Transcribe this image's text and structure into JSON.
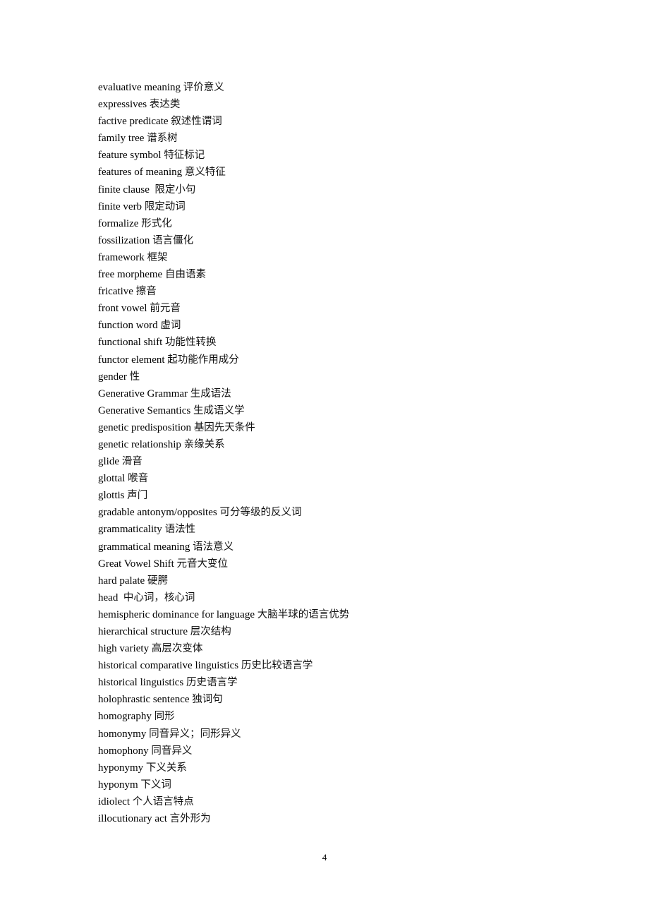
{
  "entries": [
    {
      "en": "evaluative meaning",
      "sep": " ",
      "zh": "评价意义"
    },
    {
      "en": "expressives",
      "sep": " ",
      "zh": "表达类"
    },
    {
      "en": "factive predicate",
      "sep": " ",
      "zh": "叙述性谓词"
    },
    {
      "en": "family tree",
      "sep": " ",
      "zh": "谱系树"
    },
    {
      "en": "feature symbol",
      "sep": " ",
      "zh": "特征标记"
    },
    {
      "en": "features of meaning",
      "sep": " ",
      "zh": "意义特征"
    },
    {
      "en": "finite clause",
      "sep": "  ",
      "zh": "限定小句"
    },
    {
      "en": "finite verb",
      "sep": " ",
      "zh": "限定动词"
    },
    {
      "en": "formalize",
      "sep": " ",
      "zh": "形式化"
    },
    {
      "en": "fossilization",
      "sep": " ",
      "zh": "语言僵化"
    },
    {
      "en": "framework",
      "sep": " ",
      "zh": "框架"
    },
    {
      "en": "free morpheme",
      "sep": " ",
      "zh": "自由语素"
    },
    {
      "en": "fricative",
      "sep": " ",
      "zh": "擦音"
    },
    {
      "en": "front vowel",
      "sep": " ",
      "zh": "前元音"
    },
    {
      "en": "function word",
      "sep": " ",
      "zh": "虚词"
    },
    {
      "en": "functional shift",
      "sep": " ",
      "zh": "功能性转换"
    },
    {
      "en": "functor element",
      "sep": " ",
      "zh": "起功能作用成分"
    },
    {
      "en": "gender",
      "sep": " ",
      "zh": "性"
    },
    {
      "en": "Generative Grammar",
      "sep": " ",
      "zh": "生成语法"
    },
    {
      "en": "Generative Semantics",
      "sep": " ",
      "zh": "生成语义学"
    },
    {
      "en": "genetic predisposition",
      "sep": " ",
      "zh": "基因先天条件"
    },
    {
      "en": "genetic relationship",
      "sep": " ",
      "zh": "亲缘关系"
    },
    {
      "en": "glide",
      "sep": " ",
      "zh": "滑音"
    },
    {
      "en": "glottal",
      "sep": " ",
      "zh": "喉音"
    },
    {
      "en": "glottis",
      "sep": " ",
      "zh": "声门"
    },
    {
      "en": "gradable antonym/opposites",
      "sep": " ",
      "zh": "可分等级的反义词"
    },
    {
      "en": "grammaticality",
      "sep": " ",
      "zh": "语法性"
    },
    {
      "en": "grammatical meaning",
      "sep": " ",
      "zh": "语法意义"
    },
    {
      "en": "Great Vowel Shift",
      "sep": " ",
      "zh": "元音大变位"
    },
    {
      "en": "hard palate",
      "sep": " ",
      "zh": "硬腭"
    },
    {
      "en": "head",
      "sep": "  ",
      "zh": "中心词，核心词"
    },
    {
      "en": "hemispheric dominance for language",
      "sep": " ",
      "zh": "大脑半球的语言优势"
    },
    {
      "en": "hierarchical structure",
      "sep": " ",
      "zh": "层次结构"
    },
    {
      "en": "high variety",
      "sep": " ",
      "zh": "高层次变体"
    },
    {
      "en": "historical comparative linguistics",
      "sep": " ",
      "zh": "历史比较语言学"
    },
    {
      "en": "historical linguistics",
      "sep": " ",
      "zh": "历史语言学"
    },
    {
      "en": "holophrastic sentence",
      "sep": " ",
      "zh": "独词句"
    },
    {
      "en": "homography",
      "sep": " ",
      "zh": "同形"
    },
    {
      "en": "homonymy",
      "sep": " ",
      "zh": "同音异义；同形异义"
    },
    {
      "en": "homophony",
      "sep": " ",
      "zh": "同音异义"
    },
    {
      "en": "hyponymy",
      "sep": " ",
      "zh": "下义关系"
    },
    {
      "en": "hyponym",
      "sep": " ",
      "zh": "下义词"
    },
    {
      "en": "idiolect",
      "sep": " ",
      "zh": "个人语言特点"
    },
    {
      "en": "illocutionary act",
      "sep": " ",
      "zh": "言外形为"
    }
  ],
  "page_number": "4"
}
